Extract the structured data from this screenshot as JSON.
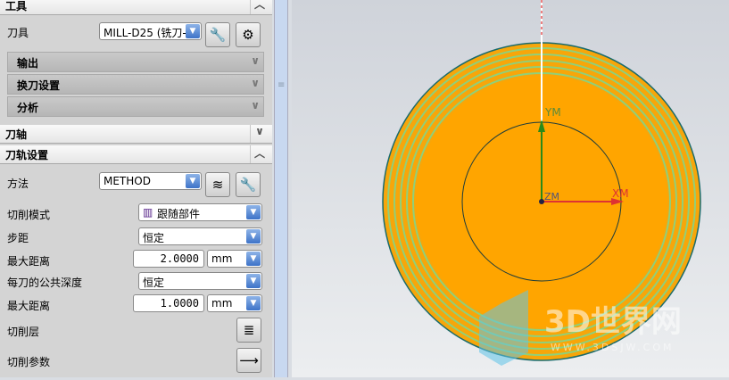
{
  "tool_section": {
    "title": "工具",
    "tool_label": "刀具",
    "tool_value": "MILL-D25 (铣刀-",
    "subs": [
      "输出",
      "换刀设置",
      "分析"
    ]
  },
  "axis_section": {
    "title": "刀轴"
  },
  "path_section": {
    "title": "刀轨设置",
    "method_label": "方法",
    "method_value": "METHOD",
    "cut_mode_label": "切削模式",
    "cut_mode_value": "跟随部件",
    "stepover_label": "步距",
    "stepover_value": "恒定",
    "max_dist_label": "最大距离",
    "max_dist_value": "2.0000",
    "max_dist_unit": "mm",
    "depth_label": "每刀的公共深度",
    "depth_value": "恒定",
    "max_dist2_label": "最大距离",
    "max_dist2_value": "1.0000",
    "max_dist2_unit": "mm",
    "levels_label": "切削层",
    "params_label": "切削参数"
  },
  "viewport": {
    "axes": {
      "x": "XM",
      "y": "YM",
      "z": "ZM"
    },
    "watermark": "3D世界网",
    "watermark_url": "WWW.3DSJW.COM"
  }
}
